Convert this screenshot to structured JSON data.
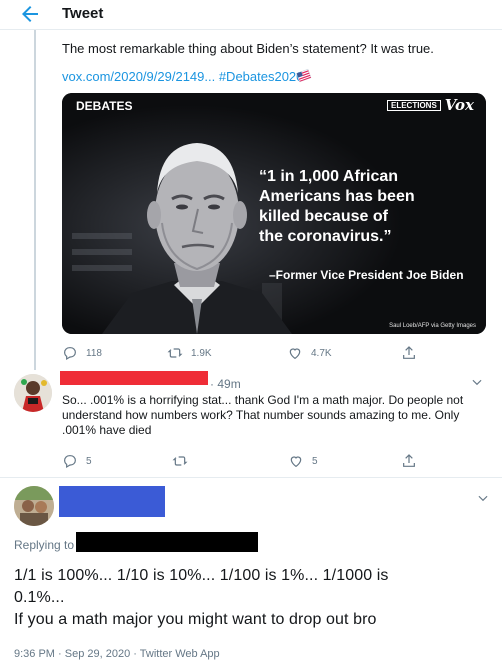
{
  "header": {
    "title": "Tweet"
  },
  "parent_tweet": {
    "text": "The most remarkable thing about Biden’s statement? It was true.",
    "link": "vox.com/2020/9/29/2149... #Debates2020",
    "card": {
      "header": "DEBATES",
      "elections": "ELECTIONS",
      "brand": "Vox",
      "quote_lines": [
        "“1 in 1,000 African",
        "Americans has been",
        "killed because of",
        "the coronavirus.”"
      ],
      "attribution": "–Former Vice President Joe Biden",
      "credit": "Saul Loeb/AFP via Getty Images"
    },
    "actions": {
      "replies": "118",
      "retweets": "1.9K",
      "likes": "4.7K"
    }
  },
  "reply": {
    "time": "49m",
    "text": "So... .001% is a horrifying stat... thank God I'm a math major. Do people not understand how numbers work? That number sounds amazing to me. Only .001% have died",
    "actions": {
      "replies": "5",
      "retweets": "",
      "likes": "5"
    }
  },
  "main_tweet": {
    "replying_to_label": "Replying to",
    "line1": "1/1 is 100%... 1/10 is 10%... 1/100 is 1%... 1/1000 is",
    "line2": "0.1%...",
    "line3": "If you a math major you might want to drop out bro",
    "meta": "9:36 PM · Sep 29, 2020 · Twitter Web App"
  },
  "colors": {
    "accent": "#1b95e0",
    "secondary_text": "#657786",
    "redaction_red": "#ef2d37",
    "redaction_blue": "#3b5bd6",
    "redaction_black": "#000000"
  },
  "icons": [
    "back-arrow-icon",
    "reply-icon",
    "retweet-icon",
    "like-icon",
    "share-icon",
    "chevron-down-icon",
    "flag-emoji-icon"
  ]
}
